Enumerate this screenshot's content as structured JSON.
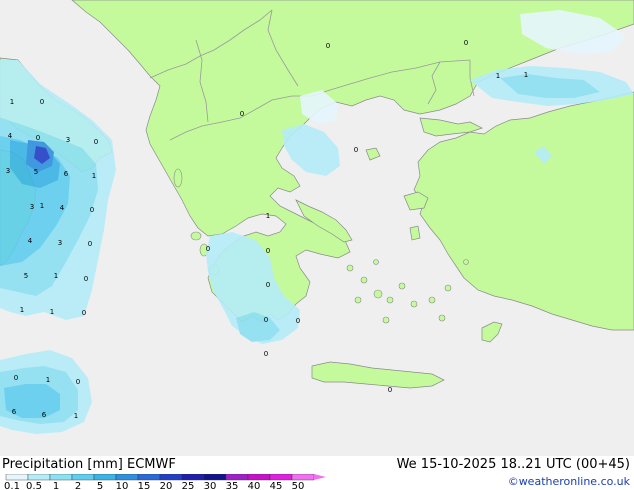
{
  "footer": {
    "title": "Precipitation [mm] ECMWF",
    "datetime": "We 15-10-2025 18..21 UTC (00+45)",
    "credit": "©weatheronline.co.uk"
  },
  "legend": {
    "ticks": [
      "0.1",
      "0.5",
      "1",
      "2",
      "5",
      "10",
      "15",
      "20",
      "25",
      "30",
      "35",
      "40",
      "45",
      "50"
    ],
    "colors": [
      "#e6f6fd",
      "#b5ecf8",
      "#8ce0f3",
      "#5fcdee",
      "#3ab3e6",
      "#2e8fde",
      "#2a6ad6",
      "#233fc6",
      "#1f1fae",
      "#13138a",
      "#a020c8",
      "#c810c8",
      "#e020e0",
      "#f070f0"
    ]
  },
  "colors": {
    "sea": "#efefef",
    "land": "#c4fa9c",
    "coast": "#8a8a8a",
    "border": "#9a9a9a"
  },
  "precip_labels": [
    "1",
    "0",
    "0",
    "0",
    "0",
    "1",
    "1",
    "0",
    "4",
    "0",
    "3",
    "0",
    "3",
    "5",
    "6",
    "1",
    "3",
    "1",
    "4",
    "0",
    "4",
    "3",
    "0",
    "5",
    "1",
    "0",
    "1",
    "1",
    "0",
    "1",
    "0",
    "0",
    "0",
    "0",
    "0",
    "0",
    "0",
    "1",
    "0",
    "6",
    "6",
    "1",
    "0"
  ]
}
